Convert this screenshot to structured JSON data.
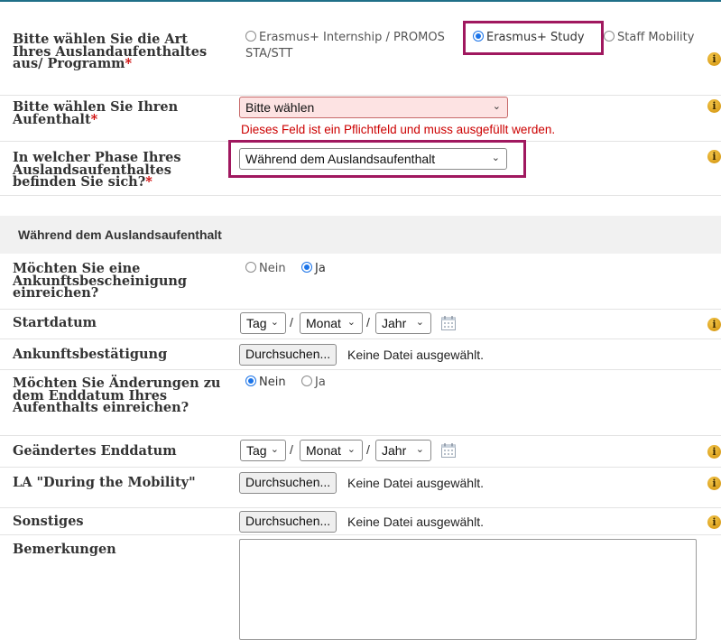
{
  "colors": {
    "highlight": "#a0185f",
    "error": "#cc0000",
    "radio_selected": "#1a73e8",
    "info": "#e0a21a",
    "top_line": "#1f6f88"
  },
  "form": {
    "program": {
      "label": "Bitte wählen Sie die Art Ihres Auslandaufenthaltes aus/ Programm",
      "required_mark": "*",
      "options": [
        "Erasmus+ Internship / PROMOS",
        "Erasmus+ Study",
        "Staff Mobility",
        "STA/STT"
      ],
      "selected": "Erasmus+ Study"
    },
    "stay": {
      "label": "Bitte wählen Sie Ihren Aufenthalt",
      "required_mark": "*",
      "value": "Bitte wählen",
      "error": "Dieses Feld ist ein Pflichtfeld und muss ausgefüllt werden."
    },
    "phase": {
      "label": "In welcher Phase Ihres Auslandsaufenthaltes befinden Sie sich?",
      "required_mark": "*",
      "value": "Während dem Auslandsaufenthalt"
    }
  },
  "section": {
    "title": "Während dem Auslandsaufenthalt"
  },
  "arrival_cert_question": {
    "label": "Möchten Sie eine Ankunftsbescheinigung einreichen?",
    "options": [
      "Nein",
      "Ja"
    ],
    "selected": "Ja"
  },
  "date_parts": {
    "day": "Tag",
    "month": "Monat",
    "year": "Jahr",
    "separator": "/"
  },
  "start_date": {
    "label": "Startdatum"
  },
  "arrival_confirmation": {
    "label": "Ankunftsbestätigung"
  },
  "file": {
    "button": "Durchsuchen...",
    "none": "Keine Datei ausgewählt."
  },
  "end_date_question": {
    "label": "Möchten Sie Änderungen zu dem Enddatum Ihres Aufenthalts einreichen?",
    "options": [
      "Nein",
      "Ja"
    ],
    "selected": "Nein"
  },
  "changed_end_date": {
    "label": "Geändertes Enddatum"
  },
  "la_during": {
    "label": "LA \"During the Mobility\""
  },
  "other": {
    "label": "Sonstiges"
  },
  "remarks": {
    "label": "Bemerkungen",
    "value": ""
  },
  "icons": {
    "info": "info-icon",
    "calendar": "calendar-icon",
    "caret": "chevron-down-icon"
  },
  "info_glyph": "i"
}
